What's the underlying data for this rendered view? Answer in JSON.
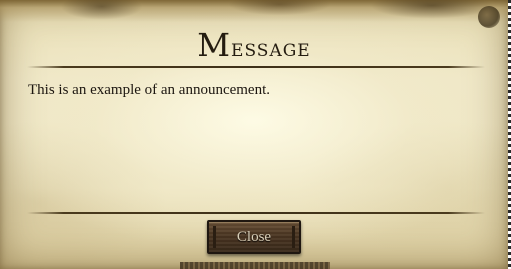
{
  "dialog": {
    "title_cap": "M",
    "title_rest": "essage",
    "body": "This is an example of an announcement.",
    "close_label": "Close"
  },
  "colors": {
    "parchment": "#eee6c3",
    "ink": "#241c10",
    "button_wood": "#4b3622",
    "button_text": "#d9cfb8"
  }
}
